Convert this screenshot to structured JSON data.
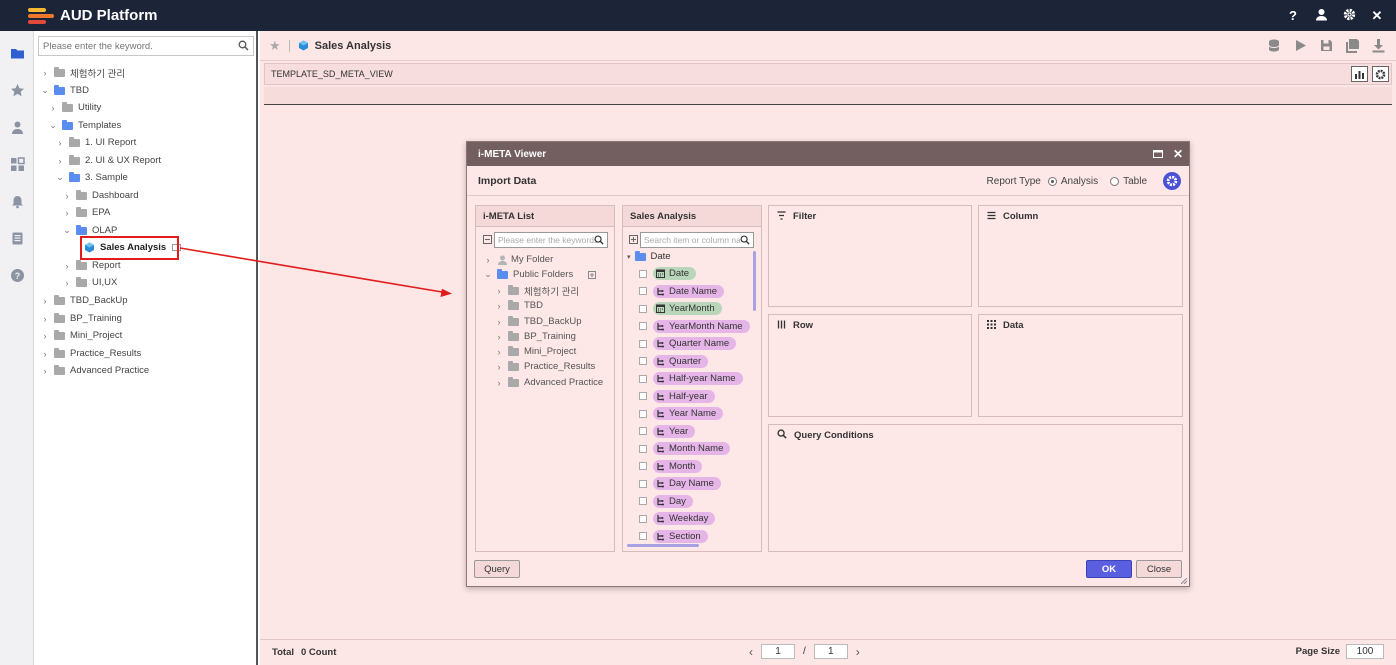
{
  "app": {
    "title": "AUD Platform"
  },
  "top_icons": [
    "help-icon",
    "user-icon",
    "settings-icon",
    "close-icon"
  ],
  "rail": [
    "folder-icon",
    "star-icon",
    "person-icon",
    "dashboard-icon",
    "alarm-icon",
    "document-icon",
    "help-icon"
  ],
  "tree": {
    "search_placeholder": "Please enter the keyword.",
    "items": [
      {
        "label": "체험하기 관리"
      },
      {
        "label": "TBD"
      },
      {
        "label": "Utility"
      },
      {
        "label": "Templates"
      },
      {
        "label": "1. UI Report"
      },
      {
        "label": "2. UI & UX Report"
      },
      {
        "label": "3. Sample"
      },
      {
        "label": "Dashboard"
      },
      {
        "label": "EPA"
      },
      {
        "label": "OLAP"
      },
      {
        "label": "Sales Analysis"
      },
      {
        "label": "Report"
      },
      {
        "label": "UI,UX"
      },
      {
        "label": "TBD_BackUp"
      },
      {
        "label": "BP_Training"
      },
      {
        "label": "Mini_Project"
      },
      {
        "label": "Practice_Results"
      },
      {
        "label": "Advanced Practice"
      }
    ]
  },
  "main": {
    "title": "Sales Analysis",
    "view_label": "TEMPLATE_SD_META_VIEW",
    "footer": {
      "total": "Total",
      "count": "0 Count",
      "page": "1",
      "slash": "/",
      "pages": "1",
      "page_size_label": "Page Size",
      "page_size": "100"
    }
  },
  "dialog": {
    "title": "i-META Viewer",
    "subtitle": "Import Data",
    "report_type_label": "Report Type",
    "opt_analysis": "Analysis",
    "opt_table": "Table",
    "meta_list": {
      "header": "i-META List",
      "search_placeholder": "Please enter the keywords",
      "items": [
        {
          "label": "My Folder"
        },
        {
          "label": "Public Folders"
        },
        {
          "label": "체험하기 관리"
        },
        {
          "label": "TBD"
        },
        {
          "label": "TBD_BackUp"
        },
        {
          "label": "BP_Training"
        },
        {
          "label": "Mini_Project"
        },
        {
          "label": "Practice_Results"
        },
        {
          "label": "Advanced Practice"
        }
      ]
    },
    "sales_analysis": {
      "header": "Sales Analysis",
      "search_placeholder": "Search item or column name",
      "folder": "Date",
      "items": [
        {
          "label": "Date",
          "kind": "green"
        },
        {
          "label": "Date Name",
          "kind": "purple"
        },
        {
          "label": "YearMonth",
          "kind": "green"
        },
        {
          "label": "YearMonth Name",
          "kind": "purple"
        },
        {
          "label": "Quarter Name",
          "kind": "purple"
        },
        {
          "label": "Quarter",
          "kind": "purple"
        },
        {
          "label": "Half-year Name",
          "kind": "purple"
        },
        {
          "label": "Half-year",
          "kind": "purple"
        },
        {
          "label": "Year Name",
          "kind": "purple"
        },
        {
          "label": "Year",
          "kind": "purple"
        },
        {
          "label": "Month Name",
          "kind": "purple"
        },
        {
          "label": "Month",
          "kind": "purple"
        },
        {
          "label": "Day Name",
          "kind": "purple"
        },
        {
          "label": "Day",
          "kind": "purple"
        },
        {
          "label": "Weekday",
          "kind": "purple"
        },
        {
          "label": "Section",
          "kind": "purple"
        }
      ]
    },
    "zones": {
      "filter": "Filter",
      "column": "Column",
      "row": "Row",
      "data": "Data",
      "query_conditions": "Query Conditions"
    },
    "buttons": {
      "query": "Query",
      "ok": "OK",
      "close": "Close"
    }
  },
  "colors": {
    "accent": "#5a5fe0",
    "highlight": "#e21b1b",
    "topbar": "#1c2438",
    "dialog_title": "#735f5f"
  }
}
